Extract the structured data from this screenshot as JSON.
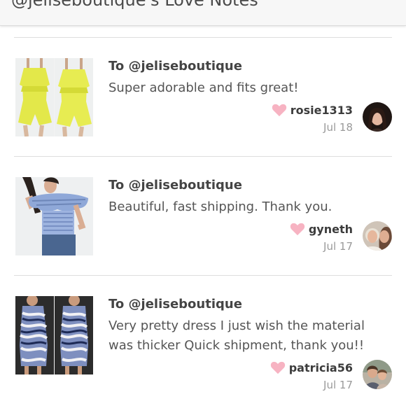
{
  "header": {
    "title": "@jeliseboutique's Love Notes"
  },
  "notes": [
    {
      "to": "To @jeliseboutique",
      "message": "Super adorable and fits great!",
      "username": "rosie1313",
      "date": "Jul 18",
      "product_icon": "yellow-romper-photo",
      "avatar_icon": "user-photo"
    },
    {
      "to": "To @jeliseboutique",
      "message": "Beautiful, fast shipping. Thank you.",
      "username": "gyneth",
      "date": "Jul 17",
      "product_icon": "blue-ruffle-top-photo",
      "avatar_icon": "user-photo"
    },
    {
      "to": "To @jeliseboutique",
      "message": "Very pretty dress I just wish the material was thicker Quick shipment, thank you!!",
      "username": "patricia56",
      "date": "Jul 17",
      "product_icon": "zebra-dress-photo",
      "avatar_icon": "user-photo"
    }
  ],
  "colors": {
    "heart": "#f7b3c2",
    "divider": "#dedede",
    "date": "#9a9a9a"
  }
}
